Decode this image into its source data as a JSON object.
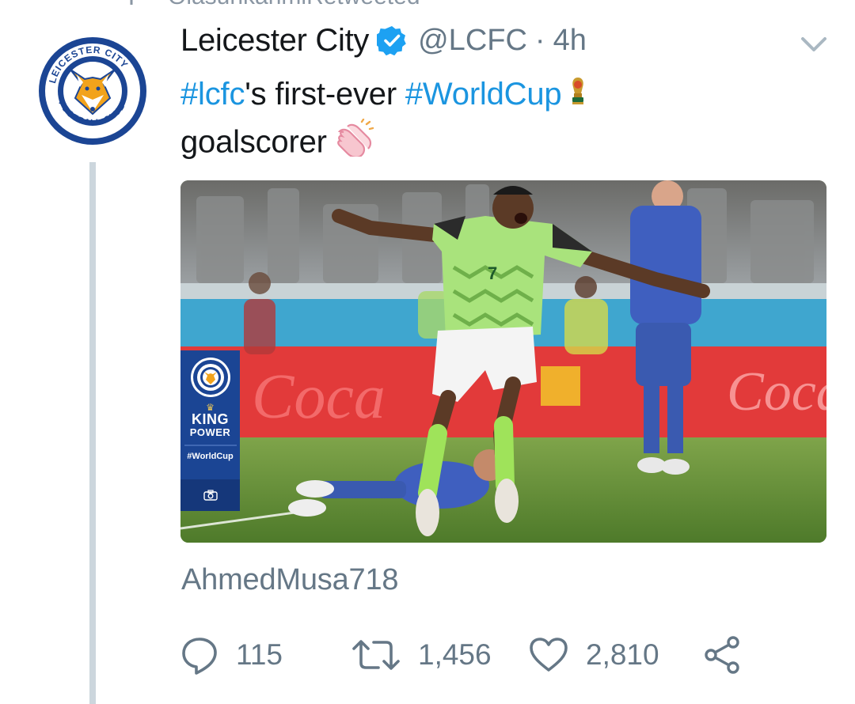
{
  "context": {
    "retweeted_text": "OlasunkanmiRetweeted",
    "icon": "retweet-icon"
  },
  "tweet": {
    "author_name": "Leicester City",
    "verified": true,
    "handle": "@LCFC",
    "separator": "·",
    "time": "4h",
    "text_parts": {
      "tag1": "#lcfc",
      "mid": "'s first-ever ",
      "tag2": "#WorldCup",
      "line2": "goalscorer"
    },
    "emojis": [
      "world-cup-trophy-icon",
      "clapping-hands-icon"
    ],
    "attribution": "AhmedMusa718"
  },
  "media_overlay": {
    "brand_line1": "KING",
    "brand_line2": "POWER",
    "hashtag": "#WorldCup",
    "icon": "camera-icon"
  },
  "actions": {
    "reply_count": "115",
    "retweet_count": "1,456",
    "like_count": "2,810"
  },
  "colors": {
    "link": "#1b95e0",
    "muted": "#657786",
    "verified": "#1da1f2",
    "lcfc_blue": "#1b4594"
  }
}
